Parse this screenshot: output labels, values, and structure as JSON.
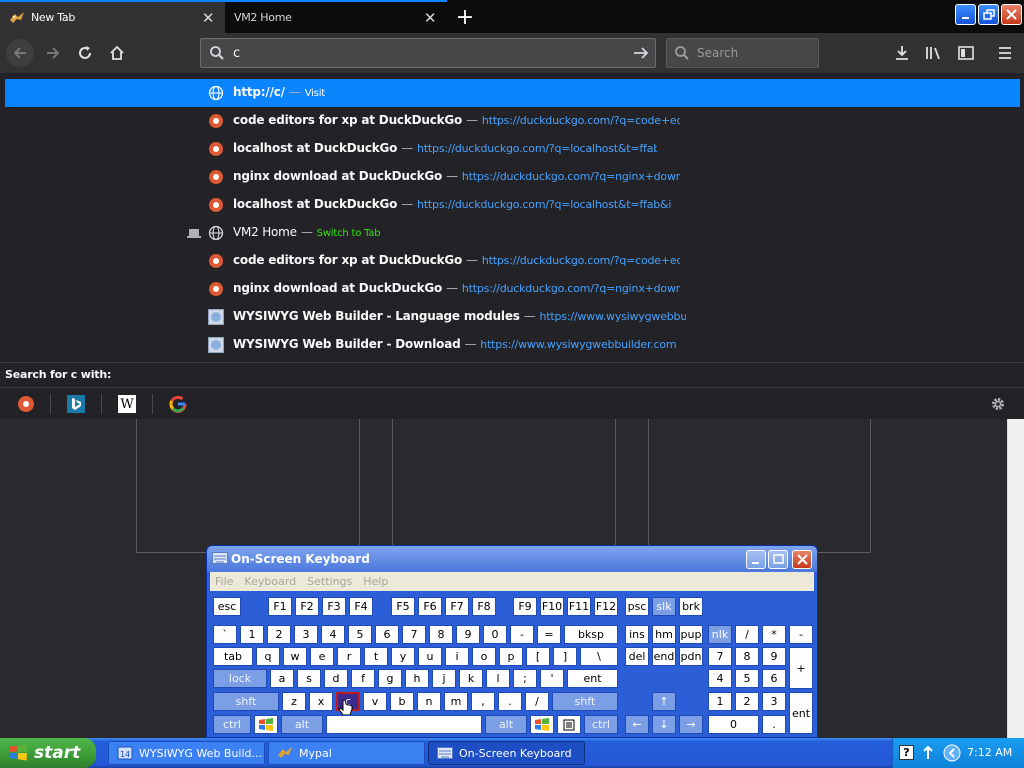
{
  "tabs": [
    {
      "label": "New Tab",
      "active": true
    },
    {
      "label": "VM2 Home",
      "active": false
    }
  ],
  "urlbar": {
    "value": "c"
  },
  "searchbar": {
    "placeholder": "Search"
  },
  "suggestions": [
    {
      "type": "visit",
      "title": "http://c/",
      "separator": "—",
      "action": "Visit",
      "icon": "globe-icon"
    },
    {
      "type": "history",
      "title": "code editors for xp at DuckDuckGo",
      "separator": "—",
      "url": "https://duckduckgo.com/?q=code+edit",
      "icon": "duckduckgo-icon"
    },
    {
      "type": "history",
      "title": "localhost at DuckDuckGo",
      "separator": "—",
      "url": "https://duckduckgo.com/?q=localhost&t=ffab",
      "icon": "duckduckgo-icon"
    },
    {
      "type": "history",
      "title": "nginx download at DuckDuckGo",
      "separator": "—",
      "url": "https://duckduckgo.com/?q=nginx+downloa",
      "icon": "duckduckgo-icon"
    },
    {
      "type": "history",
      "title": "localhost at DuckDuckGo",
      "separator": "—",
      "url": "https://duckduckgo.com/?q=localhost&t=ffab&ia=w",
      "icon": "duckduckgo-icon"
    },
    {
      "type": "switch",
      "title": "VM2 Home",
      "separator": "—",
      "action": "Switch to Tab",
      "icon": "globe-icon"
    },
    {
      "type": "history",
      "title": "code editors for xp at DuckDuckGo",
      "separator": "—",
      "url": "https://duckduckgo.com/?q=code+edit",
      "icon": "duckduckgo-icon"
    },
    {
      "type": "history",
      "title": "nginx download at DuckDuckGo",
      "separator": "—",
      "url": "https://duckduckgo.com/?q=nginx+downloa",
      "icon": "duckduckgo-icon"
    },
    {
      "type": "history",
      "title": "WYSIWYG Web Builder - Language modules",
      "separator": "—",
      "url": "https://www.wysiwygwebbuil",
      "icon": "wysiwyg-icon"
    },
    {
      "type": "history",
      "title": "WYSIWYG Web Builder - Download",
      "separator": "—",
      "url": "https://www.wysiwygwebbuilder.com/do",
      "icon": "wysiwyg-icon"
    }
  ],
  "search_with": {
    "label": "Search for c with:"
  },
  "engines": [
    "duckduckgo-icon",
    "bing-icon",
    "wikipedia-icon",
    "google-icon"
  ],
  "osk": {
    "title": "On-Screen Keyboard",
    "menu": [
      "File",
      "Keyboard",
      "Settings",
      "Help"
    ],
    "keys": {
      "fn": [
        "esc",
        "F1",
        "F2",
        "F3",
        "F4",
        "F5",
        "F6",
        "F7",
        "F8",
        "F9",
        "F10",
        "F11",
        "F12",
        "psc",
        "slk",
        "brk"
      ],
      "row1": [
        "`",
        "1",
        "2",
        "3",
        "4",
        "5",
        "6",
        "7",
        "8",
        "9",
        "0",
        "-",
        "=",
        "bksp"
      ],
      "row2": [
        "tab",
        "q",
        "w",
        "e",
        "r",
        "t",
        "y",
        "u",
        "i",
        "o",
        "p",
        "[",
        "]",
        "\\"
      ],
      "row3": [
        "lock",
        "a",
        "s",
        "d",
        "f",
        "g",
        "h",
        "j",
        "k",
        "l",
        ";",
        "'",
        "ent"
      ],
      "row4": [
        "shft",
        "z",
        "x",
        "c",
        "v",
        "b",
        "n",
        "m",
        ",",
        ".",
        "/",
        "shft"
      ],
      "row5": [
        "ctrl",
        "alt",
        "alt",
        "ctrl"
      ],
      "nav": [
        "ins",
        "hm",
        "pup",
        "del",
        "end",
        "pdn"
      ],
      "num": [
        "nlk",
        "/",
        "*",
        "-",
        "7",
        "8",
        "9",
        "+",
        "4",
        "5",
        "6",
        "1",
        "2",
        "3",
        "ent",
        "0",
        "."
      ]
    },
    "pressed_key": "c"
  },
  "taskbar": {
    "start_label": "start",
    "tasks": [
      {
        "label": "WYSIWYG Web Build...",
        "badge": "14"
      },
      {
        "label": "Mypal"
      },
      {
        "label": "On-Screen Keyboard",
        "active": true
      }
    ],
    "clock": "7:12 AM"
  }
}
